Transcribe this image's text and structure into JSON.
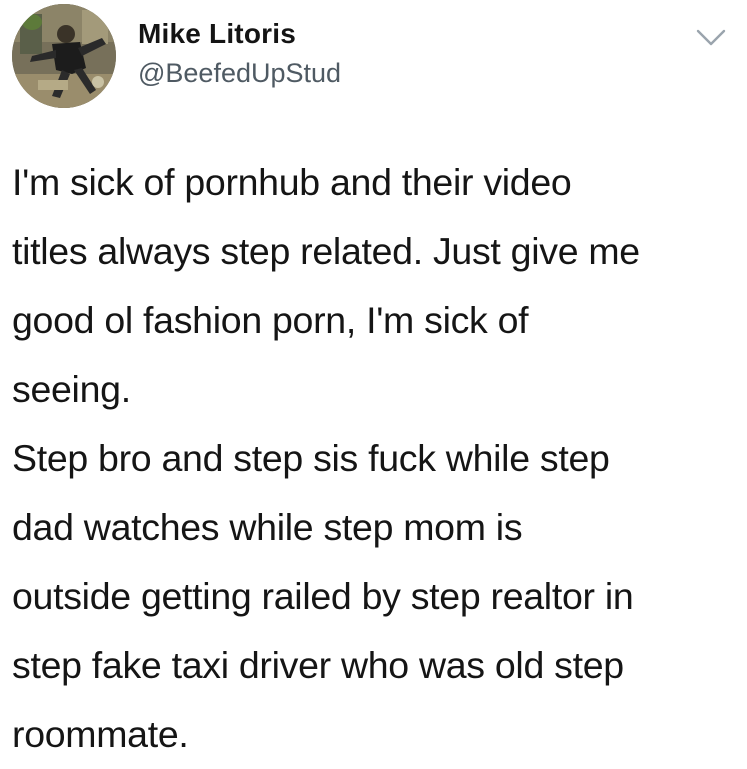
{
  "user": {
    "display_name": "Mike Litoris",
    "handle": "@BeefedUpStud",
    "avatar_icon": "profile-photo"
  },
  "menu": {
    "icon": "chevron-down-icon",
    "color": "#9aa4ad"
  },
  "tweet": {
    "lines": [
      "I'm sick of pornhub and their video",
      "titles always step related. Just give me",
      "good ol fashion porn, I'm sick of",
      "seeing.",
      "Step bro and step sis fuck while step",
      "dad watches while step mom is",
      "outside getting railed by step realtor in",
      "step fake taxi driver who was old step",
      "roommate."
    ]
  },
  "colors": {
    "name": "#141414",
    "handle": "#4f5a63",
    "text": "#151515",
    "background": "#ffffff"
  }
}
